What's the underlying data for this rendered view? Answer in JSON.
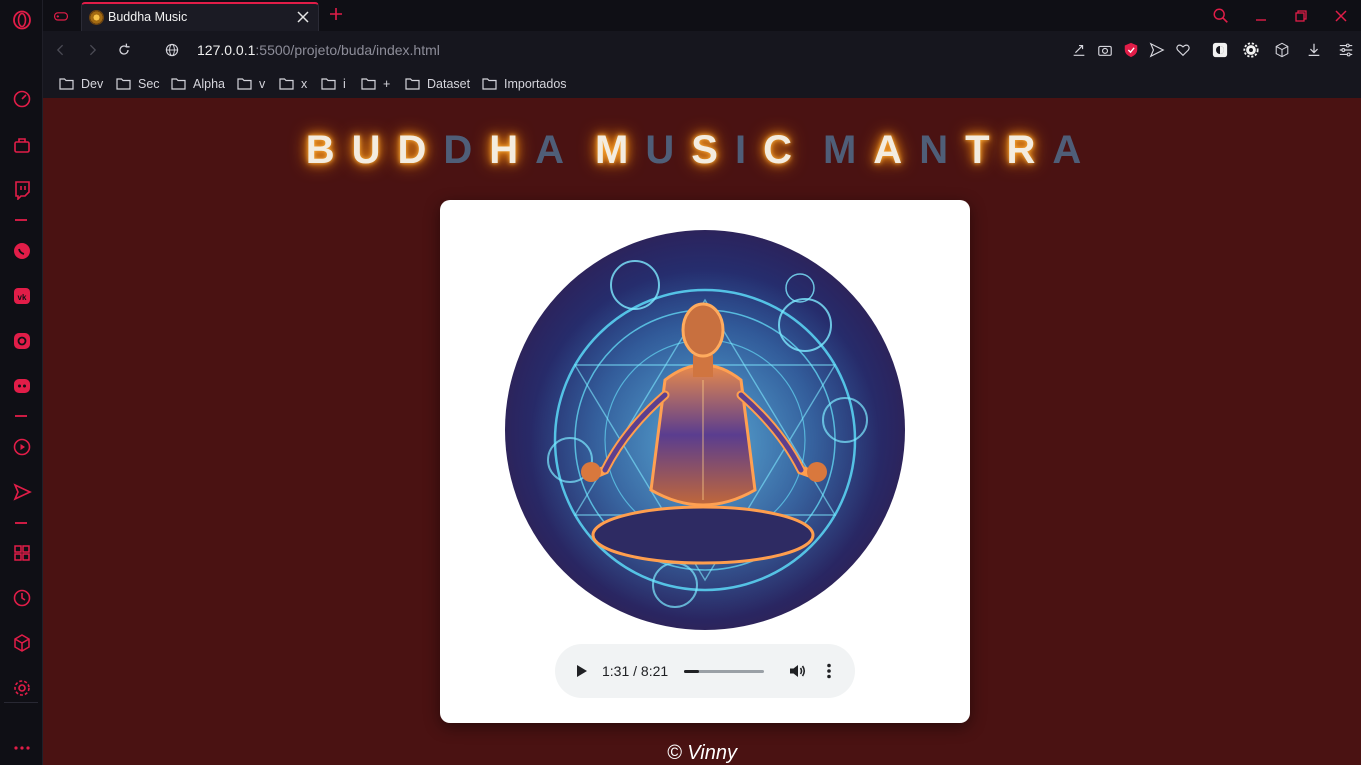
{
  "browser": {
    "tab_title": "Buddha Music",
    "url_host": "127.0.0.1",
    "url_rest": ":5500/projeto/buda/index.html",
    "accent_color": "#e11d48"
  },
  "bookmarks": [
    "Dev",
    "Sec",
    "Alpha",
    "v",
    "x",
    "i",
    "+",
    "Dataset",
    "Importados"
  ],
  "sidebar_icons": [
    "opera-logo-icon",
    "speed-dial-icon",
    "shopping-icon",
    "twitch-icon",
    "whatsapp-icon",
    "vk-icon",
    "instagram-icon",
    "discord-icon",
    "player-icon",
    "send-icon",
    "apps-icon",
    "history-icon",
    "box-icon",
    "settings-icon",
    "more-icon"
  ],
  "page": {
    "background": "#4a1212",
    "title_letters": [
      {
        "ch": "B",
        "lit": true
      },
      {
        "ch": "U",
        "lit": true
      },
      {
        "ch": "D",
        "lit": true
      },
      {
        "ch": "D",
        "lit": false
      },
      {
        "ch": "H",
        "lit": true
      },
      {
        "ch": "A",
        "lit": false
      },
      {
        "ch": " ",
        "lit": false
      },
      {
        "ch": "M",
        "lit": true
      },
      {
        "ch": "U",
        "lit": false
      },
      {
        "ch": "S",
        "lit": true
      },
      {
        "ch": "I",
        "lit": false
      },
      {
        "ch": "C",
        "lit": true
      },
      {
        "ch": " ",
        "lit": false
      },
      {
        "ch": "M",
        "lit": false
      },
      {
        "ch": "A",
        "lit": true
      },
      {
        "ch": "N",
        "lit": false
      },
      {
        "ch": "T",
        "lit": true
      },
      {
        "ch": "R",
        "lit": true
      },
      {
        "ch": "A",
        "lit": false
      }
    ],
    "player": {
      "time_label": "1:31 / 8:21",
      "progress_fraction": 0.182
    },
    "footer": "© Vinny"
  }
}
